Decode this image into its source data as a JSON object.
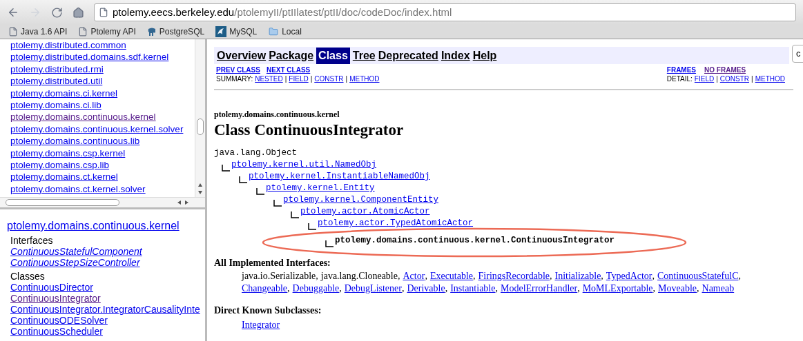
{
  "toolbar": {
    "back_disabled": false,
    "forward_disabled": true,
    "url": {
      "host": "ptolemy.eecs.berkeley.edu",
      "path": "/ptolemyII/ptIIlatest/ptII/doc/codeDoc/index.html"
    }
  },
  "bookmarks": [
    {
      "label": "Java 1.6 API",
      "kind": "page"
    },
    {
      "label": "Ptolemy API",
      "kind": "page"
    },
    {
      "label": "PostgreSQL",
      "kind": "elephant"
    },
    {
      "label": "MySQL",
      "kind": "dolphin"
    },
    {
      "label": "Local",
      "kind": "folder"
    }
  ],
  "packages_frame": {
    "items": [
      {
        "label": "ptolemy.distributed.common",
        "visited": false
      },
      {
        "label": "ptolemy.distributed.domains.sdf.kernel",
        "visited": false
      },
      {
        "label": "ptolemy.distributed.rmi",
        "visited": false
      },
      {
        "label": "ptolemy.distributed.util",
        "visited": false
      },
      {
        "label": "ptolemy.domains.ci.kernel",
        "visited": false
      },
      {
        "label": "ptolemy.domains.ci.lib",
        "visited": false
      },
      {
        "label": "ptolemy.domains.continuous.kernel",
        "visited": true
      },
      {
        "label": "ptolemy.domains.continuous.kernel.solver",
        "visited": false
      },
      {
        "label": "ptolemy.domains.continuous.lib",
        "visited": false
      },
      {
        "label": "ptolemy.domains.csp.kernel",
        "visited": false
      },
      {
        "label": "ptolemy.domains.csp.lib",
        "visited": false
      },
      {
        "label": "ptolemy.domains.ct.kernel",
        "visited": false
      },
      {
        "label": "ptolemy.domains.ct.kernel.solver",
        "visited": false
      }
    ]
  },
  "classes_frame": {
    "package": "ptolemy.domains.continuous.kernel",
    "sections": [
      {
        "heading": "Interfaces",
        "italic": true,
        "items": [
          {
            "label": "ContinuousStatefulComponent",
            "visited": false
          },
          {
            "label": "ContinuousStepSizeController",
            "visited": false
          }
        ]
      },
      {
        "heading": "Classes",
        "italic": false,
        "items": [
          {
            "label": "ContinuousDirector",
            "visited": false
          },
          {
            "label": "ContinuousIntegrator",
            "visited": true
          },
          {
            "label": "ContinuousIntegrator.IntegratorCausalityInte",
            "visited": false
          },
          {
            "label": "ContinuousODESolver",
            "visited": false
          },
          {
            "label": "ContinuousScheduler",
            "visited": false
          }
        ]
      }
    ]
  },
  "search_field": {
    "value": "c"
  },
  "nav": {
    "tabs": [
      {
        "label": "Overview",
        "selected": false
      },
      {
        "label": "Package",
        "selected": false
      },
      {
        "label": "Class",
        "selected": true
      },
      {
        "label": "Tree",
        "selected": false
      },
      {
        "label": "Deprecated",
        "selected": false
      },
      {
        "label": "Index",
        "selected": false
      },
      {
        "label": "Help",
        "selected": false
      }
    ],
    "left_links": [
      {
        "label": "PREV CLASS",
        "visited": false
      },
      {
        "label": "NEXT CLASS",
        "visited": false
      }
    ],
    "right_links": [
      {
        "label": "FRAMES",
        "visited": false
      },
      {
        "label": "NO FRAMES",
        "visited": true
      }
    ],
    "summary": {
      "label": "SUMMARY:",
      "links": [
        "NESTED",
        "FIELD",
        "CONSTR",
        "METHOD"
      ],
      "separator": "|"
    },
    "detail": {
      "label": "DETAIL:",
      "links": [
        "FIELD",
        "CONSTR",
        "METHOD"
      ],
      "separator": "|"
    }
  },
  "class_page": {
    "package": "ptolemy.domains.continuous.kernel",
    "title": "Class ContinuousIntegrator",
    "hierarchy": {
      "text": "java.lang.Object",
      "kind": "root",
      "children": [
        {
          "text": "ptolemy.kernel.util.NamedObj",
          "kind": "link",
          "children": [
            {
              "text": "ptolemy.kernel.InstantiableNamedObj",
              "kind": "link",
              "children": [
                {
                  "text": "ptolemy.kernel.Entity",
                  "kind": "link",
                  "children": [
                    {
                      "text": "ptolemy.kernel.ComponentEntity",
                      "kind": "link",
                      "children": [
                        {
                          "text": "ptolemy.actor.AtomicActor",
                          "kind": "link",
                          "children": [
                            {
                              "text": "ptolemy.actor.TypedAtomicActor",
                              "kind": "link",
                              "children": [
                                {
                                  "text": "ptolemy.domains.continuous.kernel.ContinuousIntegrator",
                                  "kind": "current",
                                  "highlighted": true
                                }
                              ]
                            }
                          ]
                        }
                      ]
                    }
                  ]
                }
              ]
            }
          ]
        }
      ]
    },
    "interfaces": {
      "heading": "All Implemented Interfaces:",
      "lines": [
        [
          {
            "text": "java.io.Serializable",
            "kind": "text"
          },
          {
            "text": "java.lang.Cloneable",
            "kind": "text"
          },
          {
            "text": "Actor",
            "kind": "link"
          },
          {
            "text": "Executable",
            "kind": "link"
          },
          {
            "text": "FiringsRecordable",
            "kind": "link"
          },
          {
            "text": "Initializable",
            "kind": "link"
          },
          {
            "text": "TypedActor",
            "kind": "link"
          },
          {
            "text": "ContinuousStatefulC",
            "kind": "link"
          }
        ],
        [
          {
            "text": "Changeable",
            "kind": "link"
          },
          {
            "text": "Debuggable",
            "kind": "link"
          },
          {
            "text": "DebugListener",
            "kind": "link"
          },
          {
            "text": "Derivable",
            "kind": "link"
          },
          {
            "text": "Instantiable",
            "kind": "link"
          },
          {
            "text": "ModelErrorHandler",
            "kind": "link"
          },
          {
            "text": "MoMLExportable",
            "kind": "link"
          },
          {
            "text": "Moveable",
            "kind": "link"
          },
          {
            "text": "Nameab",
            "kind": "link"
          }
        ]
      ],
      "separator": ","
    },
    "subclasses": {
      "heading": "Direct Known Subclasses:",
      "items": [
        "Integrator"
      ]
    }
  }
}
